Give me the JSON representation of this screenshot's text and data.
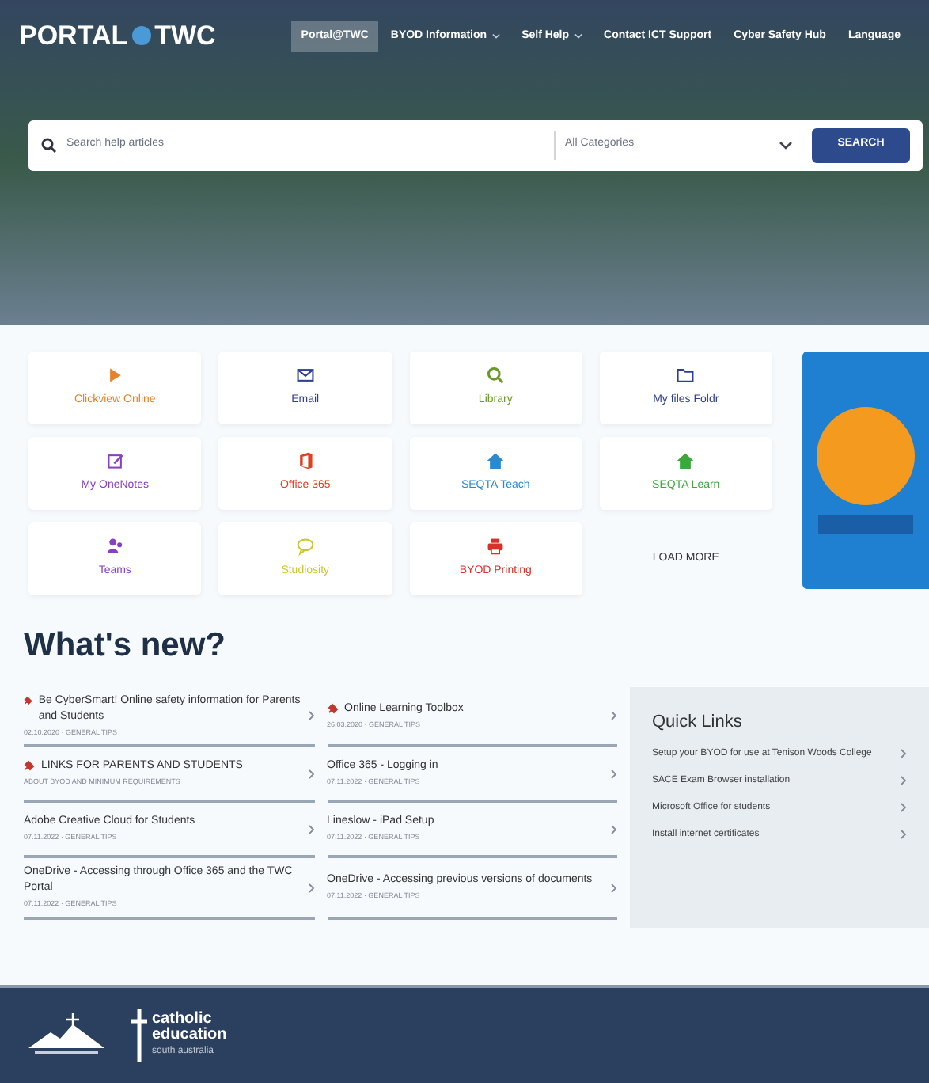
{
  "header": {
    "logo_left": "PORTAL",
    "logo_right": "TWC",
    "nav": [
      {
        "label": "Portal@TWC",
        "selected": true,
        "dropdown": false
      },
      {
        "label": "BYOD Information",
        "selected": false,
        "dropdown": true
      },
      {
        "label": "Self Help",
        "selected": false,
        "dropdown": true
      },
      {
        "label": "Contact ICT Support",
        "selected": false,
        "dropdown": false
      },
      {
        "label": "Cyber Safety Hub",
        "selected": false,
        "dropdown": false
      },
      {
        "label": "Language",
        "selected": false,
        "dropdown": false
      }
    ]
  },
  "search": {
    "placeholder": "Search help articles",
    "category": "All Categories",
    "button": "SEARCH"
  },
  "tiles": [
    {
      "label": "Clickview Online",
      "color": "#e8822a"
    },
    {
      "label": "Email",
      "color": "#2f3f8f"
    },
    {
      "label": "Library",
      "color": "#6a9a2a"
    },
    {
      "label": "My files Foldr",
      "color": "#2f3f8f"
    },
    {
      "label": "My OneNotes",
      "color": "#8a3fc0"
    },
    {
      "label": "Office 365",
      "color": "#e0401f"
    },
    {
      "label": "SEQTA Teach",
      "color": "#2a8ad0"
    },
    {
      "label": "SEQTA Learn",
      "color": "#3aa83a"
    },
    {
      "label": "Teams",
      "color": "#8a3fc0"
    },
    {
      "label": "Studiosity",
      "color": "#c8c82a"
    },
    {
      "label": "BYOD Printing",
      "color": "#d8302a"
    }
  ],
  "load_more": "LOAD MORE",
  "whats_new": {
    "title": "What's new?",
    "articles": [
      {
        "title": "Be CyberSmart! Online safety information for Parents and Students",
        "meta": "02.10.2020 · GENERAL TIPS",
        "pinned": true
      },
      {
        "title": "Online Learning Toolbox",
        "meta": "26.03.2020 · GENERAL TIPS",
        "pinned": true
      },
      {
        "title": "LINKS FOR PARENTS AND STUDENTS",
        "meta": "ABOUT BYOD AND MINIMUM REQUIREMENTS",
        "pinned": true
      },
      {
        "title": "Office 365 - Logging in",
        "meta": "07.11.2022 · GENERAL TIPS",
        "pinned": false
      },
      {
        "title": "Adobe Creative Cloud for Students",
        "meta": "07.11.2022 · GENERAL TIPS",
        "pinned": false
      },
      {
        "title": "Lineslow - iPad Setup",
        "meta": "07.11.2022 · GENERAL TIPS",
        "pinned": false
      },
      {
        "title": "OneDrive - Accessing through Office 365 and the TWC Portal",
        "meta": "07.11.2022 · GENERAL TIPS",
        "pinned": false
      },
      {
        "title": "OneDrive - Accessing previous versions of documents",
        "meta": "07.11.2022 · GENERAL TIPS",
        "pinned": false
      }
    ]
  },
  "quick_links": {
    "title": "Quick Links",
    "items": [
      "Setup your BYOD for use at Tenison Woods College",
      "SACE Exam Browser installation",
      "Microsoft Office for students",
      "Install internet certificates"
    ]
  },
  "footer": {
    "logo_lines": [
      "catholic",
      "education",
      "south australia"
    ]
  }
}
